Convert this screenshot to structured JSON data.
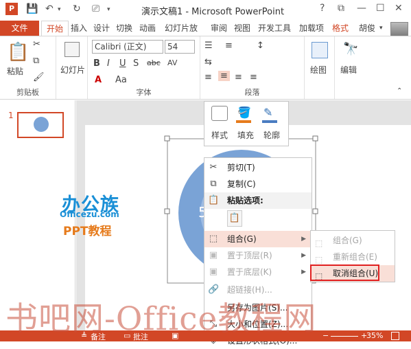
{
  "window": {
    "title": "演示文稿1 - Microsoft PowerPoint",
    "help": "?"
  },
  "tabs": {
    "file": "文件",
    "items": [
      "开始",
      "插入",
      "设计",
      "切换",
      "动画",
      "幻灯片放",
      "审阅",
      "视图",
      "开发工具",
      "加载项",
      "格式"
    ],
    "user": "胡俊"
  },
  "ribbon": {
    "clipboard": {
      "label": "剪贴板",
      "paste": "粘贴"
    },
    "slides": {
      "label": "幻灯片"
    },
    "font": {
      "label": "字体",
      "name": "Calibri (正文)",
      "size": "54",
      "bold": "B",
      "italic": "I",
      "underline": "U",
      "shadow": "S",
      "strike": "abc",
      "spacing": "AV",
      "case": "Aa",
      "color": "A"
    },
    "paragraph": {
      "label": "段落"
    },
    "drawing": {
      "label": "绘图"
    },
    "editing": {
      "label": "编辑"
    }
  },
  "slides_pane": {
    "slide_number": "1"
  },
  "mini_toolbar": {
    "style": "样式",
    "fill": "填充",
    "outline": "轮廓"
  },
  "logo": {
    "line1": "办公族",
    "line2": "Officezu.com",
    "line3": "PPT教程"
  },
  "slide_text": "5",
  "context_menu": [
    {
      "label": "剪切(T)",
      "icon": "scissors-icon",
      "enabled": true
    },
    {
      "label": "复制(C)",
      "icon": "copy-icon",
      "enabled": true
    },
    {
      "label": "粘贴选项:",
      "icon": "paste-icon",
      "enabled": true
    },
    {
      "label": "组合(G)",
      "icon": "group-icon",
      "enabled": true,
      "submenu": true,
      "highlighted": true
    },
    {
      "label": "置于顶层(R)",
      "icon": "bring-front-icon",
      "enabled": false,
      "submenu": true
    },
    {
      "label": "置于底层(K)",
      "icon": "send-back-icon",
      "enabled": false,
      "submenu": true
    },
    {
      "label": "超链接(H)...",
      "icon": "hyperlink-icon",
      "enabled": false
    },
    {
      "label": "另存为图片(S)...",
      "enabled": true
    },
    {
      "label": "大小和位置(Z)...",
      "icon": "size-position-icon",
      "enabled": true
    },
    {
      "label": "设置形状格式(O)...",
      "icon": "format-shape-icon",
      "enabled": true
    }
  ],
  "submenu": [
    {
      "label": "组合(G)",
      "enabled": false
    },
    {
      "label": "重新组合(E)",
      "enabled": false
    },
    {
      "label": "取消组合(U)",
      "enabled": true,
      "highlighted": true
    }
  ],
  "statusbar": {
    "notes": "备注",
    "comments": "批注",
    "zoom": "35%"
  },
  "watermark": "书吧网-Office教程网",
  "colors": {
    "accent": "#d24726",
    "highlight": "#f9dfd7",
    "circle": "#7aa3d6",
    "logo_blue": "#1a8fd6",
    "logo_orange": "#e67b1c"
  }
}
